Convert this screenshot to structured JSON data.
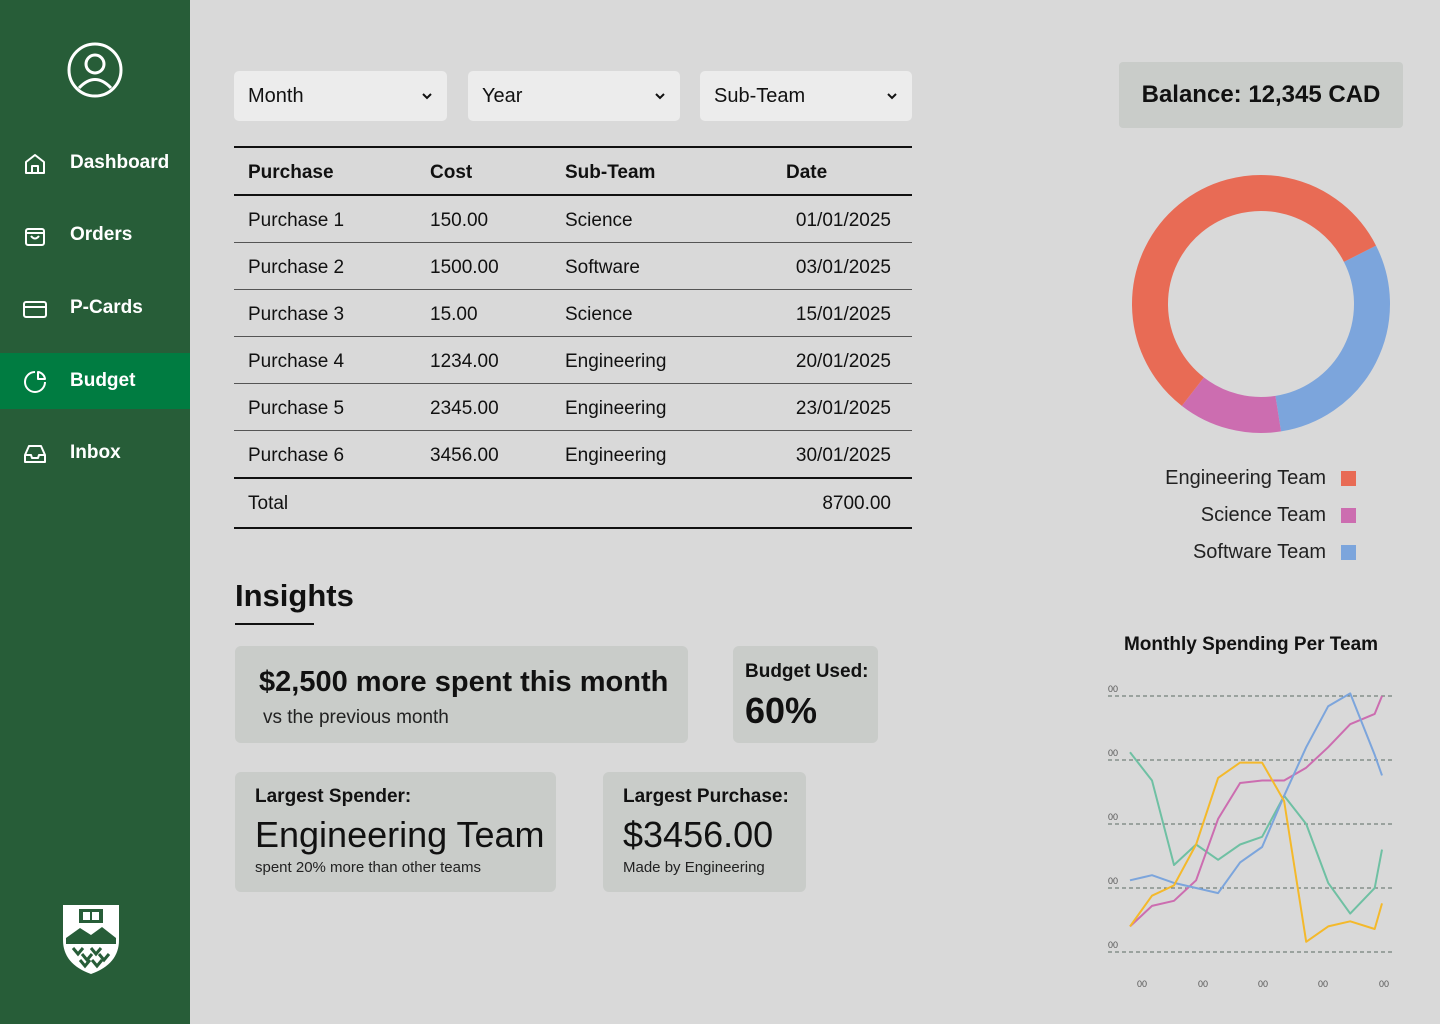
{
  "sidebar": {
    "items": [
      {
        "label": "Dashboard",
        "icon": "home-icon"
      },
      {
        "label": "Orders",
        "icon": "shopping-bag-icon"
      },
      {
        "label": "P-Cards",
        "icon": "credit-card-icon"
      },
      {
        "label": "Budget",
        "icon": "pie-chart-icon",
        "active": true
      },
      {
        "label": "Inbox",
        "icon": "inbox-icon"
      }
    ]
  },
  "filters": {
    "month": "Month",
    "year": "Year",
    "subteam": "Sub-Team"
  },
  "table": {
    "headers": [
      "Purchase",
      "Cost",
      "Sub-Team",
      "Date"
    ],
    "rows": [
      [
        "Purchase 1",
        "150.00",
        "Science",
        "01/01/2025"
      ],
      [
        "Purchase 2",
        "1500.00",
        "Software",
        "03/01/2025"
      ],
      [
        "Purchase 3",
        "15.00",
        "Science",
        "15/01/2025"
      ],
      [
        "Purchase 4",
        "1234.00",
        "Engineering",
        "20/01/2025"
      ],
      [
        "Purchase 5",
        "2345.00",
        "Engineering",
        "23/01/2025"
      ],
      [
        "Purchase 6",
        "3456.00",
        "Engineering",
        "30/01/2025"
      ]
    ],
    "total_label": "Total",
    "total_value": "8700.00"
  },
  "insights": {
    "title": "Insights",
    "spend": {
      "headline": "$2,500 more spent this month",
      "sub": "vs the previous month"
    },
    "budget": {
      "label": "Budget Used:",
      "value": "60%"
    },
    "spender": {
      "label": "Largest Spender:",
      "value": "Engineering Team",
      "sub": "spent 20% more than other teams"
    },
    "purchase": {
      "label": "Largest Purchase:",
      "value": "$3456.00",
      "sub": "Made by Engineering"
    }
  },
  "balance": "Balance: 12,345 CAD",
  "colors": {
    "brand": "#275d38",
    "active": "#007c41",
    "engineering": "#e86b55",
    "science": "#cc6db0",
    "software": "#7ca5dc",
    "line_yellow": "#f4b92b",
    "line_green": "#6fc0a3"
  },
  "chart_data": [
    {
      "type": "pie",
      "legend": [
        {
          "name": "Engineering Team",
          "color": "#e86b55"
        },
        {
          "name": "Science Team",
          "color": "#cc6db0"
        },
        {
          "name": "Software Team",
          "color": "#7ca5dc"
        }
      ],
      "values": [
        57,
        13,
        30
      ],
      "legend_position": "bottom"
    },
    {
      "type": "line",
      "title": "Monthly Spending Per Team",
      "y_tick_labels": [
        "00",
        "00",
        "00",
        "00",
        "00"
      ],
      "x_tick_labels": [
        "00",
        "00",
        "00",
        "00",
        "00"
      ],
      "xlim": [
        0,
        1
      ],
      "ylim": [
        0,
        100
      ],
      "grid": true,
      "series": [
        {
          "color": "#6fc0a3",
          "points": [
            [
              0.0,
              78
            ],
            [
              0.09,
              67
            ],
            [
              0.18,
              34
            ],
            [
              0.27,
              42
            ],
            [
              0.36,
              36
            ],
            [
              0.45,
              42
            ],
            [
              0.54,
              45
            ],
            [
              0.63,
              61
            ],
            [
              0.72,
              50
            ],
            [
              0.81,
              27
            ],
            [
              0.9,
              15
            ],
            [
              1.0,
              25
            ],
            [
              1.03,
              40
            ]
          ]
        },
        {
          "color": "#cc6db0",
          "points": [
            [
              0.0,
              10
            ],
            [
              0.09,
              18
            ],
            [
              0.18,
              20
            ],
            [
              0.27,
              28
            ],
            [
              0.36,
              52
            ],
            [
              0.45,
              66
            ],
            [
              0.54,
              67
            ],
            [
              0.63,
              67
            ],
            [
              0.72,
              72
            ],
            [
              0.81,
              80
            ],
            [
              0.9,
              89
            ],
            [
              1.0,
              93
            ],
            [
              1.03,
              100
            ]
          ]
        },
        {
          "color": "#7ca5dc",
          "points": [
            [
              0.0,
              28
            ],
            [
              0.09,
              30
            ],
            [
              0.18,
              27
            ],
            [
              0.27,
              25
            ],
            [
              0.36,
              23
            ],
            [
              0.45,
              35
            ],
            [
              0.54,
              41
            ],
            [
              0.63,
              61
            ],
            [
              0.72,
              80
            ],
            [
              0.81,
              96
            ],
            [
              0.9,
              101
            ],
            [
              1.0,
              77
            ],
            [
              1.03,
              69
            ]
          ]
        },
        {
          "color": "#f4b92b",
          "points": [
            [
              0.0,
              10
            ],
            [
              0.09,
              22
            ],
            [
              0.18,
              26
            ],
            [
              0.27,
              42
            ],
            [
              0.36,
              68
            ],
            [
              0.45,
              74
            ],
            [
              0.54,
              74
            ],
            [
              0.63,
              59
            ],
            [
              0.72,
              4
            ],
            [
              0.81,
              10
            ],
            [
              0.9,
              12
            ],
            [
              1.0,
              9
            ],
            [
              1.03,
              19
            ]
          ]
        }
      ]
    }
  ]
}
